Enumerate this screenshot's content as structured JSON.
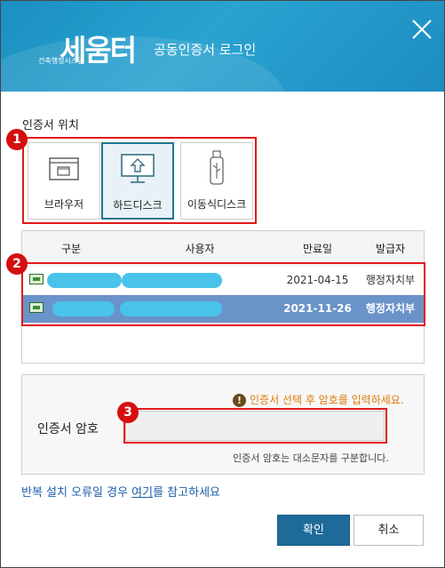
{
  "header": {
    "logo_main": "세움터",
    "logo_sub": "건축행정시스템",
    "title": "공동인증서 로그인"
  },
  "location": {
    "label": "인증서 위치",
    "buttons": [
      {
        "label": "브라우저",
        "icon": "browser-window-icon"
      },
      {
        "label": "하드디스크",
        "icon": "monitor-upload-icon",
        "active": true
      },
      {
        "label": "이동식디스크",
        "icon": "usb-drive-icon"
      }
    ]
  },
  "table": {
    "headers": [
      "구분",
      "사용자",
      "만료일",
      "발급자"
    ],
    "rows": [
      {
        "expiry": "2021-04-15",
        "issuer": "행정자치부",
        "selected": false
      },
      {
        "expiry": "2021-11-26",
        "issuer": "행정자치부",
        "selected": true
      }
    ]
  },
  "password": {
    "warning": "인증서 선택 후 암호를 입력하세요.",
    "label": "인증서 암호",
    "value": "",
    "hint": "인증서 암호는 대소문자를 구분합니다."
  },
  "help": {
    "before": "반복 설치 오류일 경우 ",
    "link": "여기",
    "after": "를 참고하세요"
  },
  "badges": [
    "1",
    "2",
    "3"
  ],
  "buttons": {
    "ok": "확인",
    "cancel": "취소"
  },
  "colors": {
    "header": "#2aa3d1",
    "selected_row": "#6a93c9",
    "primary": "#1e6b9a",
    "annotation": "#e01a1a",
    "warning": "#e07a0a"
  }
}
